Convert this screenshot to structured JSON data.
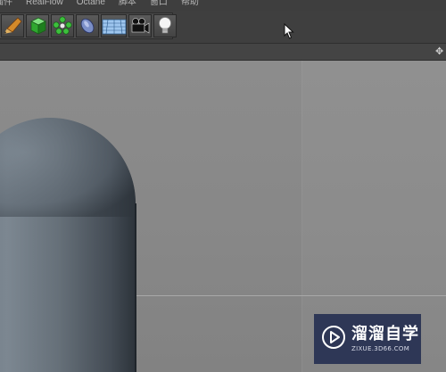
{
  "menu": {
    "items": [
      {
        "label": "插件"
      },
      {
        "label": "RealFlow"
      },
      {
        "label": "Octane"
      },
      {
        "label": "脚本"
      },
      {
        "label": "窗口"
      },
      {
        "label": "帮助"
      }
    ]
  },
  "toolbar": {
    "tools": [
      {
        "icon": "pencil-icon"
      },
      {
        "icon": "cube-deformer-icon"
      },
      {
        "icon": "cloner-icon"
      },
      {
        "icon": "sweep-icon"
      },
      {
        "icon": "floor-grid-icon"
      },
      {
        "icon": "camera-icon"
      },
      {
        "icon": "light-bulb-icon"
      }
    ]
  },
  "viewport": {
    "background_color": "#8a8a8a",
    "object": "capsule"
  },
  "watermark": {
    "title": "溜溜自学",
    "url": "ZIXUE.3D66.COM",
    "background_color": "#1f294e"
  }
}
